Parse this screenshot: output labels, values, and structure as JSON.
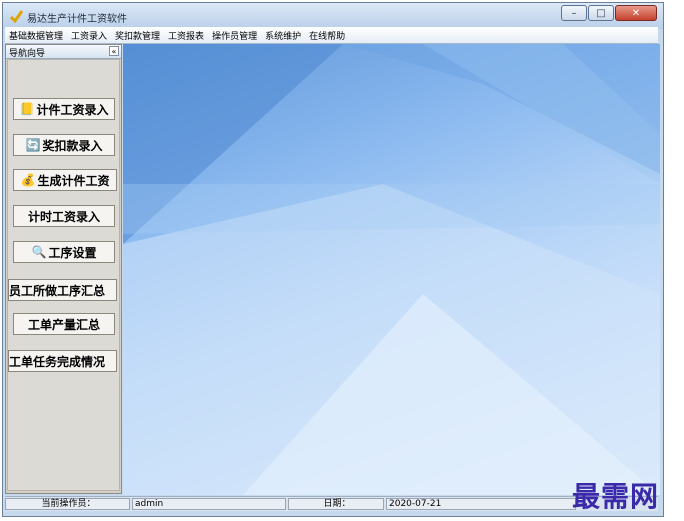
{
  "window": {
    "title": "易达生产计件工资软件",
    "controls": {
      "minimize": "–",
      "maximize": "□",
      "close": "✕"
    }
  },
  "menu": [
    "基础数据管理",
    "工资录入",
    "奖扣款管理",
    "工资报表",
    "操作员管理",
    "系统维护",
    "在线帮助"
  ],
  "nav": {
    "title": "导航向导",
    "collapse": "«",
    "buttons": [
      {
        "label": "计件工资录入",
        "icon": "📒"
      },
      {
        "label": "奖扣款录入",
        "icon": "🔄"
      },
      {
        "label": "生成计件工资",
        "icon": "💰"
      },
      {
        "label": "计时工资录入",
        "icon": ""
      },
      {
        "label": "工序设置",
        "icon": "🔍"
      },
      {
        "label": "员工所做工序汇总",
        "icon": ""
      },
      {
        "label": "工单产量汇总",
        "icon": ""
      },
      {
        "label": "工单任务完成情况",
        "icon": ""
      }
    ]
  },
  "status": {
    "operator_label": "当前操作员：",
    "operator_value": "admin",
    "date_label": "日期：",
    "date_value": "2020-07-21"
  },
  "watermark": "最需网",
  "colors": {
    "accent": "#5f96d8",
    "nav_bg": "#d4d0c8",
    "watermark": "#3a29a8"
  }
}
